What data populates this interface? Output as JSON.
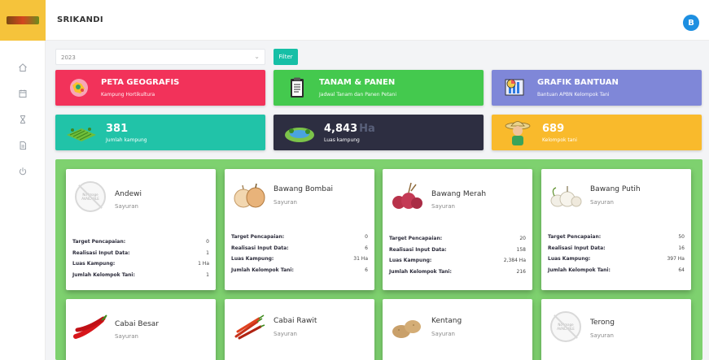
{
  "header": {
    "title": "SRIKANDI",
    "avatar_letter": "B"
  },
  "sidebar": {
    "items": [
      {
        "icon": "home-icon"
      },
      {
        "icon": "calendar-icon"
      },
      {
        "icon": "hourglass-icon"
      },
      {
        "icon": "document-icon"
      },
      {
        "icon": "power-icon"
      }
    ]
  },
  "filter": {
    "year": "2023",
    "button_label": "Filter"
  },
  "tiles": {
    "peta": {
      "title": "PETA GEOGRAFIS",
      "subtitle": "Kampung Hortikultura",
      "color": "#f2325a"
    },
    "tanam": {
      "title": "TANAM & PANEN",
      "subtitle": "Jadwal Tanam dan Panen Petani",
      "color": "#44c94e"
    },
    "grafik": {
      "title": "GRAFIK BANTUAN",
      "subtitle": "Bantuan APBN Kelompok Tani",
      "color": "#7f87d8"
    },
    "kampung": {
      "value": "381",
      "label": "Jumlah kampung",
      "color": "#21c3a8"
    },
    "luas": {
      "value": "4,843",
      "unit": "Ha",
      "label": "Luas kampung",
      "color": "#2d2e41"
    },
    "kelompok": {
      "value": "689",
      "label": "Kelompok tani",
      "color": "#f9ba2c"
    }
  },
  "stat_labels": {
    "target": "Target Pencapaian:",
    "realisasi": "Realisasi Input Data:",
    "luas": "Luas Kampung:",
    "kelompok": "Jumlah Kelompok Tani:"
  },
  "no_image_text": "No Image AVAILABLE",
  "commodities": [
    {
      "name": "Andewi",
      "category": "Sayuran",
      "image": "no-image",
      "target": "0",
      "realisasi": "1",
      "luas": "1 Ha",
      "kelompok": "1"
    },
    {
      "name": "Bawang Bombai",
      "category": "Sayuran",
      "image": "onion",
      "target": "0",
      "realisasi": "6",
      "luas": "31 Ha",
      "kelompok": "6"
    },
    {
      "name": "Bawang Merah",
      "category": "Sayuran",
      "image": "shallot",
      "target": "20",
      "realisasi": "158",
      "luas": "2,384 Ha",
      "kelompok": "216"
    },
    {
      "name": "Bawang Putih",
      "category": "Sayuran",
      "image": "garlic",
      "target": "50",
      "realisasi": "16",
      "luas": "397 Ha",
      "kelompok": "64"
    },
    {
      "name": "Cabai Besar",
      "category": "Sayuran",
      "image": "red-chili"
    },
    {
      "name": "Cabai Rawit",
      "category": "Sayuran",
      "image": "bird-chili"
    },
    {
      "name": "Kentang",
      "category": "Sayuran",
      "image": "potato"
    },
    {
      "name": "Terong",
      "category": "Sayuran",
      "image": "no-image"
    }
  ]
}
